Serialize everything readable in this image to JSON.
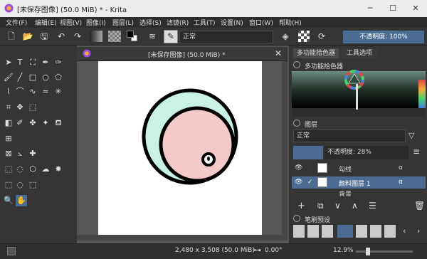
{
  "window": {
    "title": "[未保存图像]  (50.0 MiB) * - Krita",
    "minimize": "─",
    "maximize": "☐",
    "close": "✕"
  },
  "menu": [
    "文件(F)",
    "编辑(E)",
    "视图(V)",
    "图像(I)",
    "图层(L)",
    "选择(S)",
    "滤镜(R)",
    "工具(T)",
    "设置(N)",
    "窗口(W)",
    "帮助(H)"
  ],
  "toolbar": {
    "blend_mode": "正常",
    "opacity_label": "不透明度: 100%"
  },
  "document": {
    "tab_title": "[未保存图像]  (50.0 MiB) *"
  },
  "dock": {
    "tabs": [
      "多功能拾色器",
      "工具选项"
    ],
    "color_selector_title": "多功能拾色器",
    "layers_title": "图层",
    "layer_blend_mode": "正常",
    "layer_opacity": "不透明度:  28%",
    "layers": [
      {
        "name": "勾线",
        "selected": false
      },
      {
        "name": "颜料图层 1",
        "selected": true
      },
      {
        "name": "背景",
        "selected": false
      }
    ],
    "brush_presets_title": "笔刷预设"
  },
  "status": {
    "size": "2,480 x 3,508 (50.0 MiB)",
    "rotation": "0.00°",
    "zoom": "12.9%"
  },
  "colors": {
    "accent": "#4c6d93",
    "fg": "#000000",
    "bg": "#ffffff",
    "mint": "#c9f2e6",
    "pink": "#f4c9c9"
  }
}
